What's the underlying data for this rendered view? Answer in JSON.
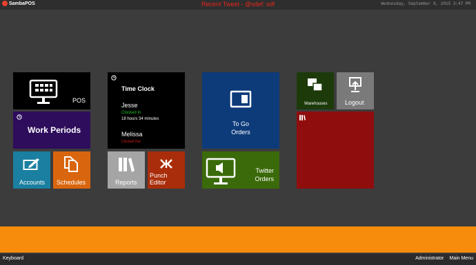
{
  "header": {
    "app_name": "SambaPOS",
    "ticker": "Recent Tweet - @sdef: sdf",
    "datetime": "Wednesday, September 9, 2015 3:47 PM"
  },
  "tiles": {
    "pos": {
      "label": "POS"
    },
    "work_periods": {
      "label": "Work Periods"
    },
    "accounts": {
      "label": "Accounts"
    },
    "schedules": {
      "label": "Schedules"
    },
    "time_clock": {
      "title": "Time Clock",
      "employees": [
        {
          "name": "Jesse",
          "status": "Clocked In",
          "duration": "18 hours 34 minutes"
        },
        {
          "name": "Melissa",
          "status": "Clocked Out"
        }
      ]
    },
    "reports": {
      "label": "Reports"
    },
    "punch_editor": {
      "label": "Punch Editor"
    },
    "to_go_orders": {
      "label_line1": "To Go",
      "label_line2": "Orders"
    },
    "twitter_orders": {
      "label_line1": "Twitter",
      "label_line2": "Orders"
    },
    "warehouses": {
      "label": "Warehouses"
    },
    "logout": {
      "label": "Logout"
    }
  },
  "statusbar": {
    "keyboard": "Keyboard",
    "user": "Administrator",
    "main_menu": "Main Menu"
  },
  "colors": {
    "background": "#3c3c3c",
    "pos": "#000000",
    "work_periods": "#2d0d5c",
    "accounts": "#1a7fa0",
    "schedules": "#d9660e",
    "time_clock": "#000000",
    "reports": "#a5a5a5",
    "punch_editor": "#a92d0a",
    "to_go_orders": "#0d3b7a",
    "twitter_orders": "#3b6a0a",
    "warehouses": "#1d3a0b",
    "logout": "#7a7a7a",
    "red_tile": "#8f0d0d",
    "footer": "#f78c0c",
    "clocked_in": "#22c02a",
    "clocked_out": "#e11b1b",
    "ticker": "#e8251b"
  },
  "icons": [
    "clock-icon",
    "keyboard-monitor-icon",
    "edit-icon",
    "documents-icon",
    "books-icon",
    "punch-editor-icon",
    "tablet-icon",
    "speaker-monitor-icon",
    "warehouse-icon",
    "logout-icon"
  ]
}
